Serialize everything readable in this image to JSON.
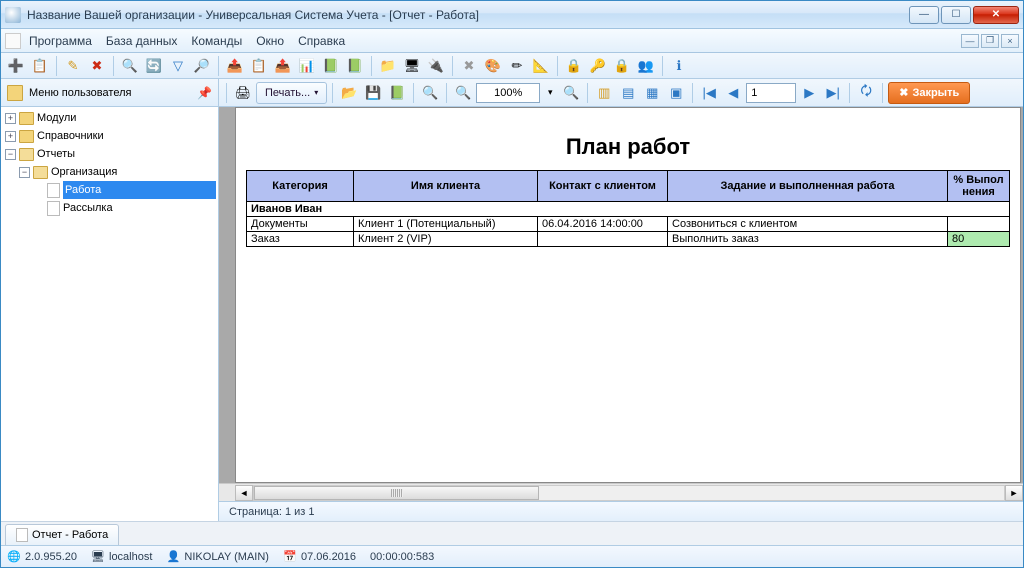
{
  "window": {
    "title": "Название Вашей организации - Универсальная Система Учета - [Отчет - Работа]"
  },
  "menu": {
    "items": [
      "Программа",
      "База данных",
      "Команды",
      "Окно",
      "Справка"
    ]
  },
  "toolbar1": {
    "groups": [
      [
        "➕",
        "📋"
      ],
      [
        "✎",
        "✖"
      ],
      [
        "🔍",
        "🔄",
        "▽",
        "🔎"
      ],
      [
        "📤",
        "📋",
        "📤",
        "📊",
        "📗",
        "📗"
      ],
      [
        "📁",
        "🖥",
        "🔌"
      ],
      [
        "✖",
        "🎨",
        "✏",
        "📐"
      ],
      [
        "🔒",
        "🔑",
        "🔒",
        "👥"
      ],
      [
        "ℹ"
      ]
    ]
  },
  "sidebar_header": {
    "label": "Меню пользователя"
  },
  "report_toolbar": {
    "print": "Печать...",
    "zoom": "100%",
    "page": "1",
    "close": "Закрыть"
  },
  "tree": {
    "modules": "Модули",
    "directories": "Справочники",
    "reports": "Отчеты",
    "organization": "Организация",
    "work": "Работа",
    "mailing": "Рассылка"
  },
  "report": {
    "title": "План работ",
    "columns": {
      "category": "Категория",
      "client_name": "Имя клиента",
      "contact": "Контакт с клиентом",
      "task": "Задание и выполненная работа",
      "pct": "% Выпол нения"
    },
    "group": "Иванов Иван",
    "rows": [
      {
        "category": "Документы",
        "client": "Клиент 1 (Потенциальный)",
        "contact": "06.04.2016 14:00:00",
        "task": "Созвониться с клиентом",
        "pct": ""
      },
      {
        "category": "Заказ",
        "client": "Клиент 2 (VIP)",
        "contact": "",
        "task": "Выполнить заказ",
        "pct": "80"
      }
    ]
  },
  "pager": {
    "label": "Страница: 1 из 1"
  },
  "tab": {
    "label": "Отчет - Работа"
  },
  "status": {
    "version": "2.0.955.20",
    "host": "localhost",
    "user": "NIKOLAY (MAIN)",
    "date": "07.06.2016",
    "elapsed": "00:00:00:583"
  }
}
